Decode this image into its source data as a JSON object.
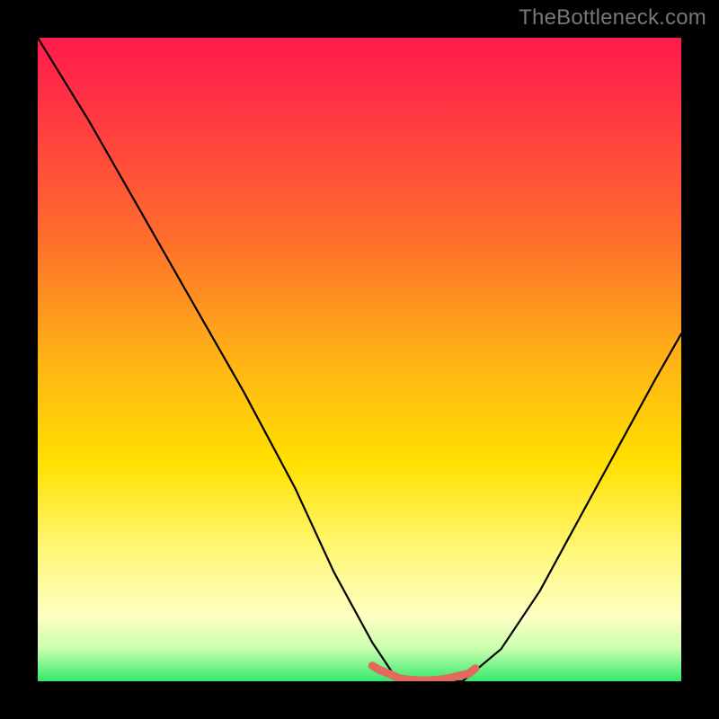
{
  "watermark": "TheBottleneck.com",
  "chart_data": {
    "type": "line",
    "title": "",
    "xlabel": "",
    "ylabel": "",
    "xlim": [
      0,
      1
    ],
    "ylim": [
      0,
      1
    ],
    "grid": false,
    "legend": false,
    "series": [
      {
        "name": "main-curve",
        "x": [
          0.0,
          0.08,
          0.16,
          0.24,
          0.32,
          0.4,
          0.46,
          0.52,
          0.56,
          0.6,
          0.66,
          0.72,
          0.78,
          0.84,
          0.9,
          0.96,
          1.0
        ],
        "y": [
          1.0,
          0.87,
          0.73,
          0.59,
          0.45,
          0.3,
          0.17,
          0.06,
          0.0,
          0.0,
          0.0,
          0.05,
          0.14,
          0.25,
          0.36,
          0.47,
          0.54
        ]
      },
      {
        "name": "trough-highlight",
        "x": [
          0.52,
          0.53,
          0.55,
          0.56,
          0.58,
          0.6,
          0.62,
          0.64,
          0.67,
          0.68
        ],
        "y": [
          0.024,
          0.018,
          0.01,
          0.005,
          0.002,
          0.001,
          0.002,
          0.005,
          0.012,
          0.02
        ]
      }
    ],
    "colors": {
      "main_curve": "#000000",
      "trough_highlight": "#e26a5c",
      "gradient_top": "#ff1a4d",
      "gradient_mid": "#ffe000",
      "gradient_bottom": "#33e86e",
      "background": "#000000",
      "watermark": "#777777"
    }
  }
}
